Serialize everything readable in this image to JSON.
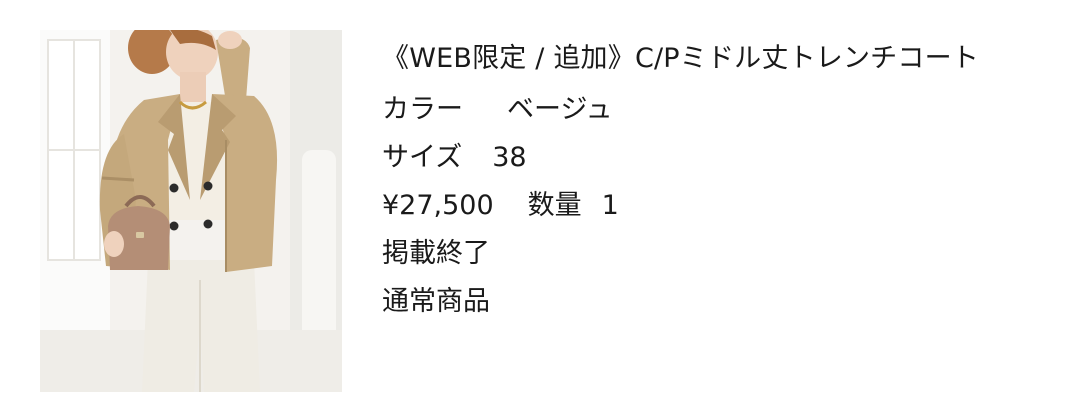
{
  "product": {
    "image": {
      "icon": "product-photo-trench-coat"
    },
    "title": "《WEB限定 / 追加》C/Pミドル丈トレンチコート",
    "color_label": "カラー",
    "color_value": "ベージュ",
    "size_label": "サイズ",
    "size_value": "38",
    "price": "¥27,500",
    "quantity_label": "数量",
    "quantity_value": "1",
    "listing_status": "掲載終了",
    "product_type": "通常商品"
  },
  "colors": {
    "background": "#ffffff",
    "text": "#1a1a1a",
    "coat": "#c9ad82",
    "pants": "#efece4"
  }
}
